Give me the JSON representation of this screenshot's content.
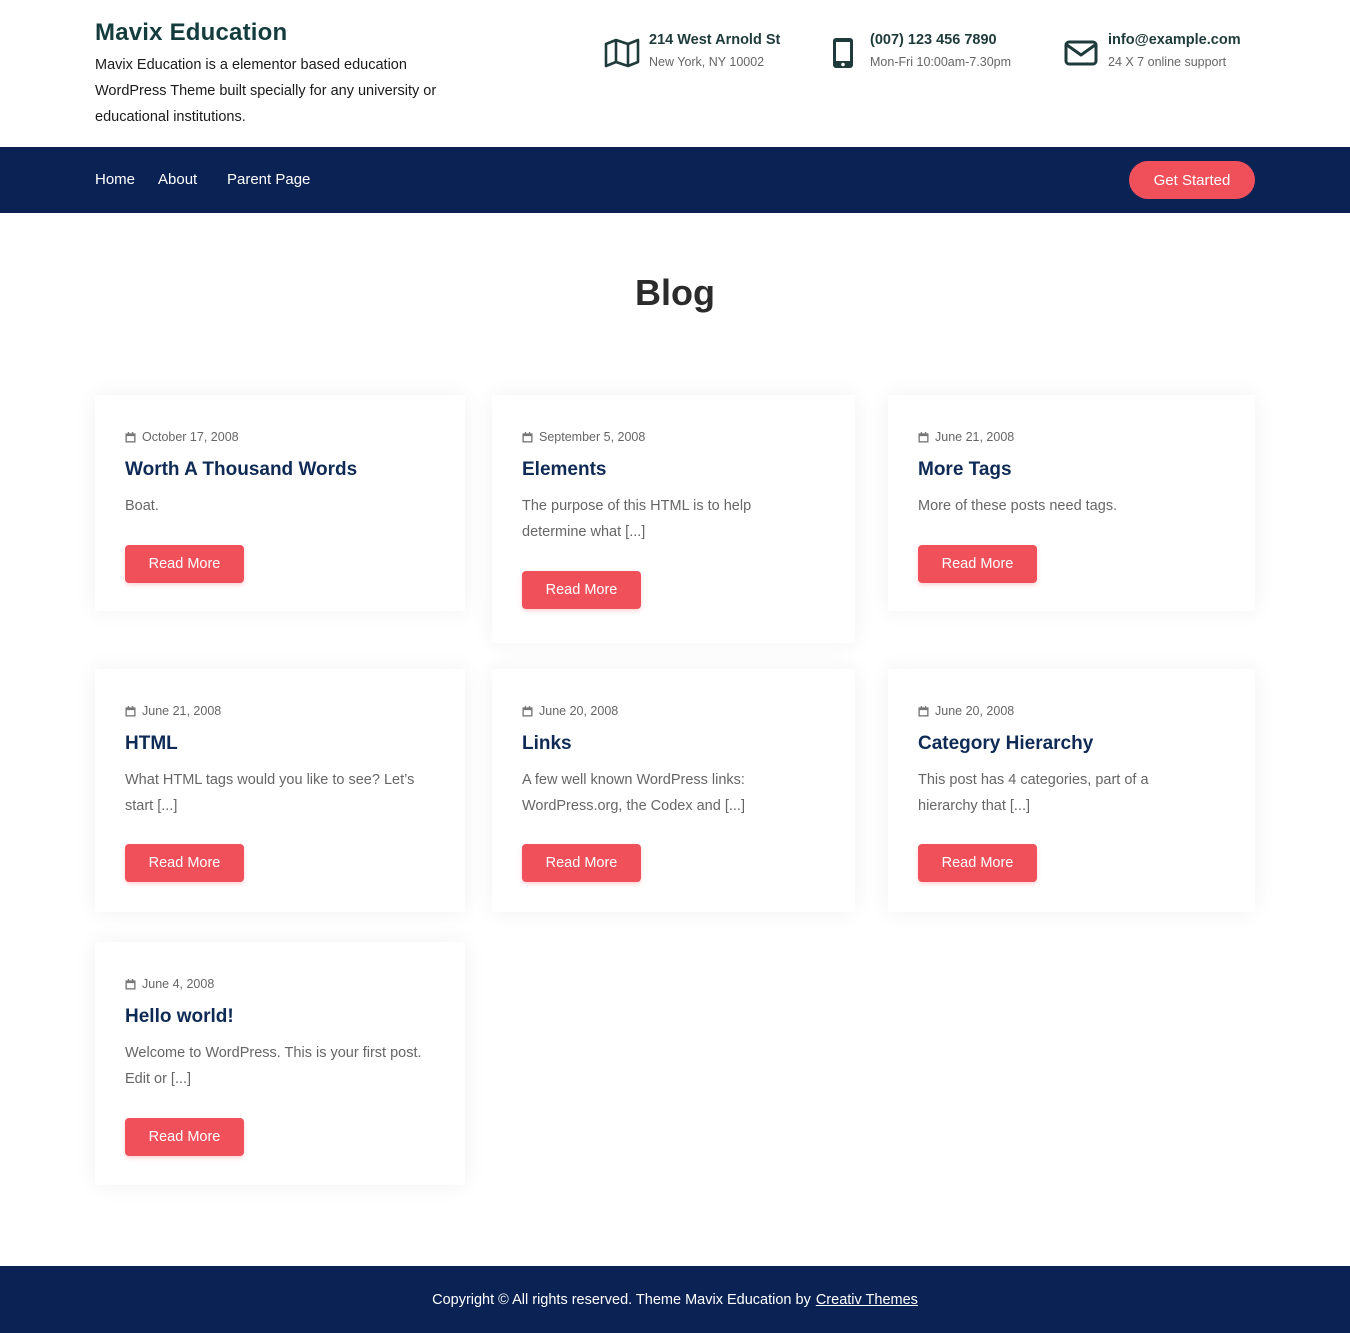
{
  "brand": {
    "title": "Mavix Education",
    "description": "Mavix Education is a elementor based education WordPress Theme built specially for any university or educational institutions."
  },
  "contact": {
    "address": {
      "icon": "map-icon",
      "line1": "214 West Arnold St",
      "line2": "New York, NY 10002"
    },
    "phone": {
      "icon": "mobile-phone-icon",
      "line1": "(007) 123 456 7890",
      "line2": "Mon-Fri 10:00am-7.30pm"
    },
    "email": {
      "icon": "envelope-icon",
      "line1": "info@example.com",
      "line2": "24 X 7 online support"
    }
  },
  "nav": {
    "items": [
      "Home",
      "About",
      "Parent Page"
    ],
    "cta": "Get Started"
  },
  "page": {
    "title": "Blog"
  },
  "posts": [
    {
      "date": "October 17, 2008",
      "title": "Worth A Thousand Words",
      "excerpt": "Boat.",
      "button": "Read More"
    },
    {
      "date": "September 5, 2008",
      "title": "Elements",
      "excerpt": "The purpose of this HTML is to help determine what [...]",
      "button": "Read More"
    },
    {
      "date": "June 21, 2008",
      "title": "More Tags",
      "excerpt": "More of these posts need tags.",
      "button": "Read More"
    },
    {
      "date": "June 21, 2008",
      "title": "HTML",
      "excerpt": "What HTML tags would you like to see? Let’s start [...]",
      "button": "Read More"
    },
    {
      "date": "June 20, 2008",
      "title": "Links",
      "excerpt": "A few well known WordPress links: WordPress.org, the Codex and [...]",
      "button": "Read More"
    },
    {
      "date": "June 20, 2008",
      "title": "Category Hierarchy",
      "excerpt": "This post has 4 categories, part of a hierarchy that [...]",
      "button": "Read More"
    },
    {
      "date": "June 4, 2008",
      "title": "Hello world!",
      "excerpt": "Welcome to WordPress. This is your first post. Edit or [...]",
      "button": "Read More"
    }
  ],
  "footer": {
    "text": "Copyright © All rights reserved. Theme Mavix Education by",
    "link": "Creativ Themes"
  },
  "colors": {
    "navy": "#0b2254",
    "accent": "#f0505a",
    "heading": "#0e2a55"
  }
}
